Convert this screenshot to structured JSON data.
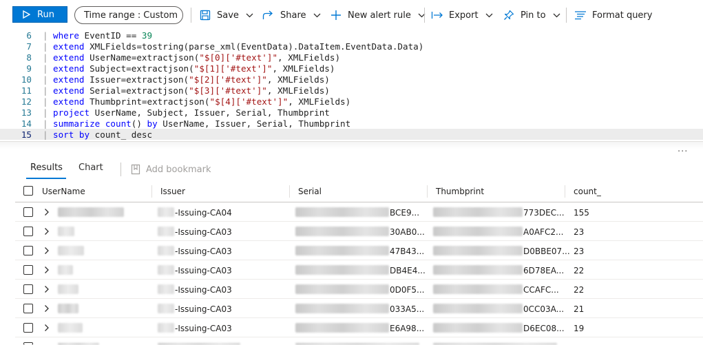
{
  "toolbar": {
    "run_label": "Run",
    "time_range_label": "Time range :",
    "time_range_value": "Custom",
    "save_label": "Save",
    "share_label": "Share",
    "new_alert_label": "New alert rule",
    "export_label": "Export",
    "pin_label": "Pin to",
    "format_label": "Format query",
    "accent_color": "#0078d4"
  },
  "editor": {
    "lines": [
      {
        "num": "6",
        "kw": "where",
        "rest": " EventID == ",
        "num_lit": "39"
      },
      {
        "num": "7",
        "kw": "extend",
        "rest": " XMLFields=tostring(parse_xml(EventData).DataItem.EventData.Data)"
      },
      {
        "num": "8",
        "kw": "extend",
        "rest": " UserName=extractjson(",
        "str": "\"$[0]['#text']\"",
        "tail": ", XMLFields)"
      },
      {
        "num": "9",
        "kw": "extend",
        "rest": " Subject=extractjson(",
        "str": "\"$[1]['#text']\"",
        "tail": ", XMLFields)"
      },
      {
        "num": "10",
        "kw": "extend",
        "rest": " Issuer=extractjson(",
        "str": "\"$[2]['#text']\"",
        "tail": ", XMLFields)"
      },
      {
        "num": "11",
        "kw": "extend",
        "rest": " Serial=extractjson(",
        "str": "\"$[3]['#text']\"",
        "tail": ", XMLFields)"
      },
      {
        "num": "12",
        "kw": "extend",
        "rest": " Thumbprint=extractjson(",
        "str": "\"$[4]['#text']\"",
        "tail": ", XMLFields)"
      },
      {
        "num": "13",
        "kw": "project",
        "rest": " UserName, Subject, Issuer, Serial, Thumbprint"
      },
      {
        "num": "14",
        "kw": "summarize",
        "fn": " count",
        "rest": "() ",
        "kw2": "by",
        "tail": " UserName, Issuer, Serial, Thumbprint"
      },
      {
        "num": "15",
        "kw": "sort by",
        "rest": " count_ desc"
      }
    ]
  },
  "results": {
    "tabs": [
      "Results",
      "Chart"
    ],
    "bookmark_label": "Add bookmark",
    "columns": [
      "UserName",
      "Issuer",
      "Serial",
      "Thumbprint",
      "count_"
    ],
    "rows": [
      {
        "issuer": "-Issuing-CA04",
        "serial": "BCE9...",
        "thumb": "773DEC...",
        "count": "155"
      },
      {
        "issuer": "-Issuing-CA03",
        "serial": "30AB0...",
        "thumb": "A0AFC2...",
        "count": "23"
      },
      {
        "issuer": "-Issuing-CA03",
        "serial": "47B43...",
        "thumb": "D0BBE07...",
        "count": "23"
      },
      {
        "issuer": "-Issuing-CA03",
        "serial": "DB4E4...",
        "thumb": "6D78EA...",
        "count": "22"
      },
      {
        "issuer": "-Issuing-CA03",
        "serial": "0D0F5...",
        "thumb": "CCAFC...",
        "count": "22"
      },
      {
        "issuer": "-Issuing-CA03",
        "serial": "033A5...",
        "thumb": "0CC03A...",
        "count": "21"
      },
      {
        "issuer": "-Issuing-CA03",
        "serial": "E6A98...",
        "thumb": "D6EC08...",
        "count": "19"
      }
    ]
  }
}
